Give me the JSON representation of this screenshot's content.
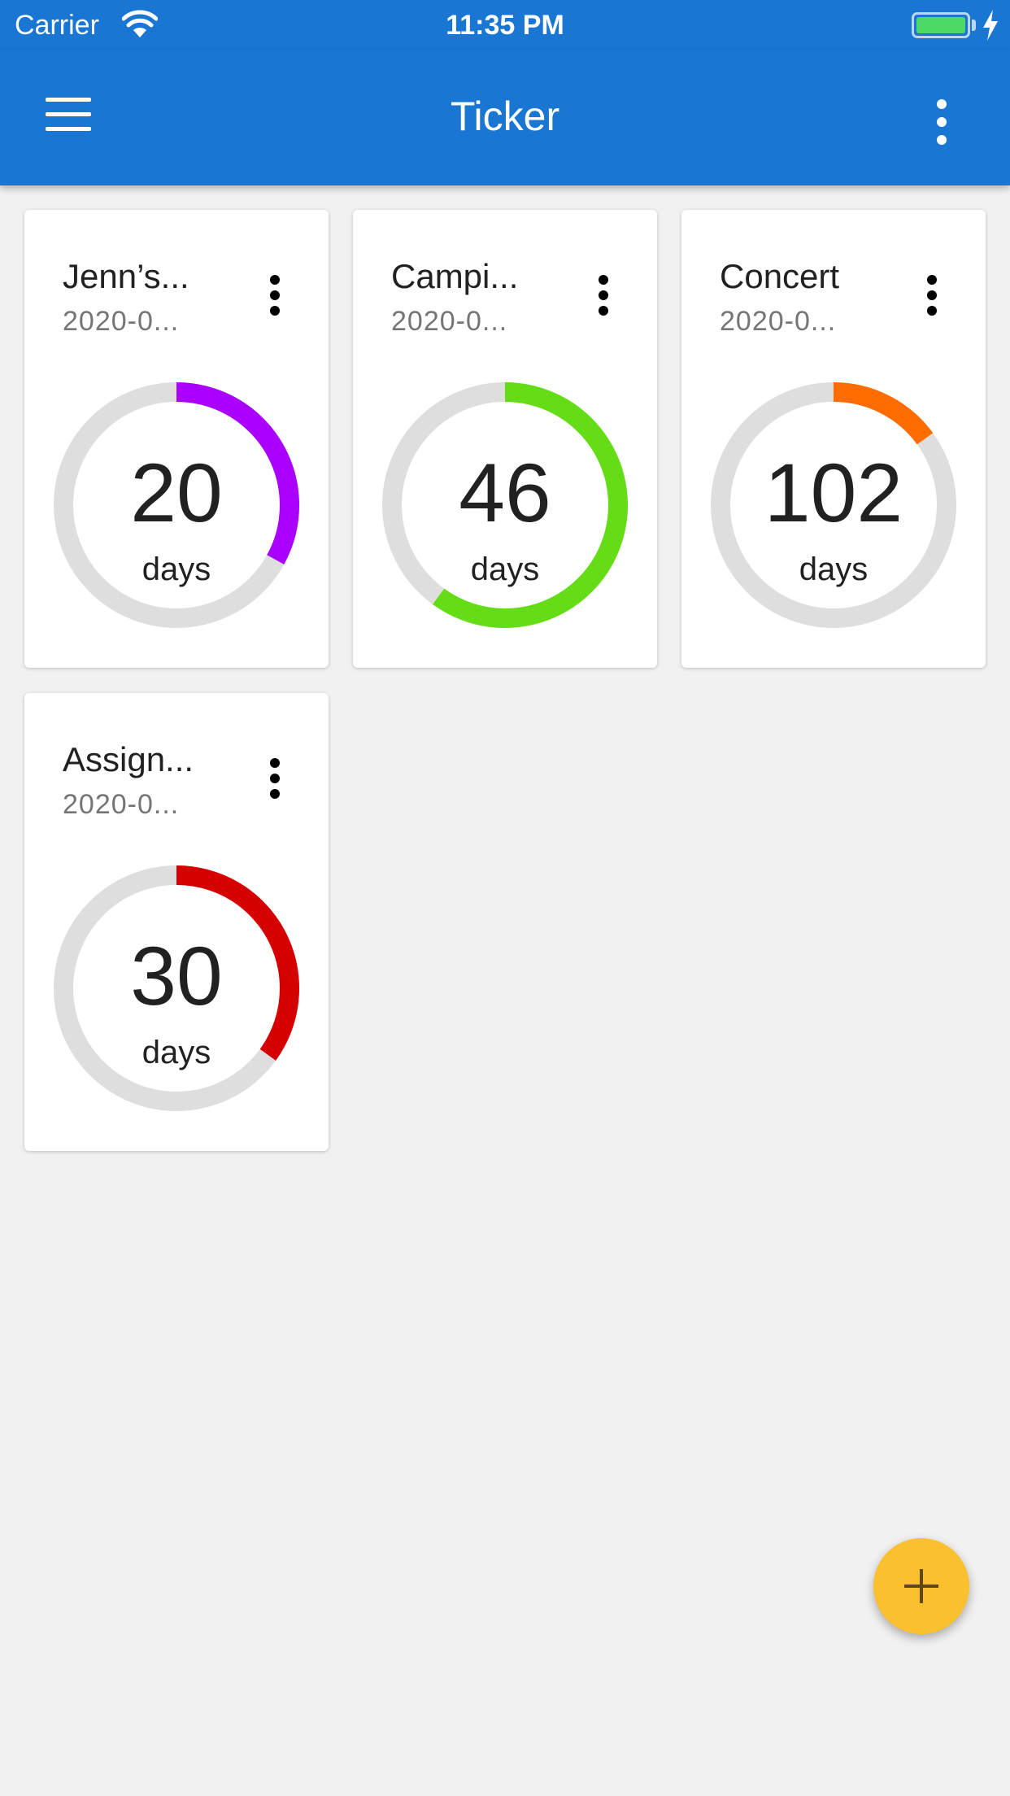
{
  "status_bar": {
    "carrier": "Carrier",
    "time": "11:35 PM"
  },
  "app_bar": {
    "title": "Ticker"
  },
  "cards": [
    {
      "title": "Jenn’s...",
      "date": "2020-0...",
      "count": "20",
      "unit": "days",
      "progress": 0.33,
      "color": "#aa00ff"
    },
    {
      "title": "Campi...",
      "date": "2020-0...",
      "count": "46",
      "unit": "days",
      "progress": 0.6,
      "color": "#64dd17"
    },
    {
      "title": "Concert",
      "date": "2020-0...",
      "count": "102",
      "unit": "days",
      "progress": 0.15,
      "color": "#ff6d00"
    },
    {
      "title": "Assign...",
      "date": "2020-0...",
      "count": "30",
      "unit": "days",
      "progress": 0.35,
      "color": "#d50000"
    }
  ],
  "icons": {
    "menu": "hamburger-icon",
    "overflow": "more-vertical-icon",
    "fab": "plus-icon"
  },
  "colors": {
    "primary": "#1976d2",
    "fab": "#fbc02d",
    "ring_track": "#dedede"
  }
}
